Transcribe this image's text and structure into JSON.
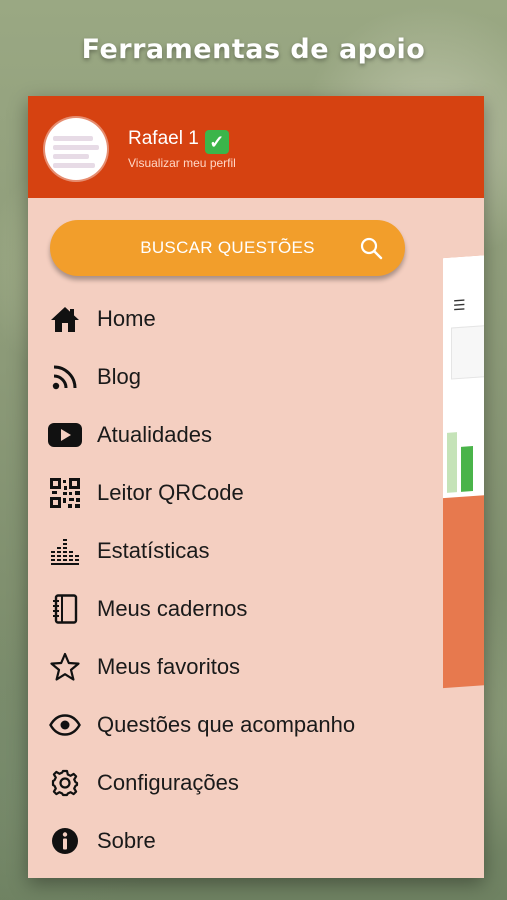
{
  "banner": {
    "title": "Ferramentas de apoio"
  },
  "drawer": {
    "user_name": "Rafael 1",
    "profile_link": "Visualizar meu perfil",
    "search_button": "BUSCAR QUESTÕES",
    "items": [
      {
        "label": "Home",
        "icon": "home-icon"
      },
      {
        "label": "Blog",
        "icon": "rss-icon"
      },
      {
        "label": "Atualidades",
        "icon": "youtube-icon"
      },
      {
        "label": "Leitor QRCode",
        "icon": "qrcode-icon"
      },
      {
        "label": "Estatísticas",
        "icon": "stats-icon"
      },
      {
        "label": "Meus cadernos",
        "icon": "notebook-icon"
      },
      {
        "label": "Meus favoritos",
        "icon": "star-icon"
      },
      {
        "label": "Questões que acompanho",
        "icon": "eye-icon"
      },
      {
        "label": "Configurações",
        "icon": "gear-icon"
      },
      {
        "label": "Sobre",
        "icon": "info-icon"
      }
    ]
  },
  "colors": {
    "header": "#d64211",
    "drawer_bg": "#f4cfc1",
    "search": "#f29e2b",
    "verified": "#3bb54a"
  }
}
